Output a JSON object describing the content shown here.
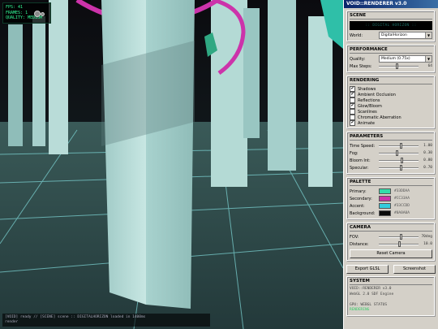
{
  "hud": {
    "lines": [
      "FPS: 41",
      "FRAMES: 1",
      "QUALITY: MEDIUM"
    ]
  },
  "console": {
    "lines": [
      "[VOID] ready // [SCENE] scene :: DIGITALHORIZON loaded in 1400ms",
      "render"
    ]
  },
  "panel": {
    "title": "VOID::RENDERER v3.0",
    "scene": {
      "heading": "SCENE",
      "banner": ":: DIGITAL HORIZON ::",
      "world_label": "World:",
      "world_value": "DigitalHorizon"
    },
    "performance": {
      "heading": "PERFORMANCE",
      "quality_label": "Quality:",
      "quality_value": "Medium (0.75x)",
      "maxsteps_label": "Max Steps:",
      "maxsteps_value": "64",
      "maxsteps_level": 0.45
    },
    "rendering": {
      "heading": "RENDERING",
      "options": [
        {
          "label": "Shadows",
          "checked": true
        },
        {
          "label": "Ambient Occlusion",
          "checked": true
        },
        {
          "label": "Reflections",
          "checked": false
        },
        {
          "label": "Glow/Bloom",
          "checked": true
        },
        {
          "label": "Scanlines",
          "checked": false
        },
        {
          "label": "Chromatic Aberration",
          "checked": false
        },
        {
          "label": "Animate",
          "checked": true
        }
      ]
    },
    "parameters": {
      "heading": "PARAMETERS",
      "items": [
        {
          "label": "Time Speed:",
          "value": "1.00",
          "level": 0.55
        },
        {
          "label": "Fog:",
          "value": "0.30",
          "level": 0.45
        },
        {
          "label": "Bloom Int:",
          "value": "0.80",
          "level": 0.58
        },
        {
          "label": "Specular:",
          "value": "0.70",
          "level": 0.55
        }
      ]
    },
    "palette": {
      "heading": "PALETTE",
      "items": [
        {
          "label": "Primary:",
          "color": "#33ddaa",
          "hex": "#33DDAA"
        },
        {
          "label": "Secondary:",
          "color": "#cc33aa",
          "hex": "#CC33AA"
        },
        {
          "label": "Accent:",
          "color": "#33ccdd",
          "hex": "#33CCDD"
        },
        {
          "label": "Background:",
          "color": "#0a0a0a",
          "hex": "#0A0A0A"
        }
      ]
    },
    "camera": {
      "heading": "CAMERA",
      "fov_label": "FOV:",
      "fov_value": "70deg",
      "fov_level": 0.55,
      "distance_label": "Distance:",
      "distance_value": "10.0",
      "distance_level": 0.5,
      "reset_label": "Reset Camera"
    },
    "actions": {
      "export_label": "Export GLSL",
      "screenshot_label": "Screenshot"
    },
    "system": {
      "heading": "SYSTEM",
      "lines": [
        "VOID::RENDERER v3.0",
        "WebGL 2.0 SDF Engine",
        "",
        "GPU: WEBGL STATUS"
      ],
      "status": "RENDERING"
    }
  }
}
